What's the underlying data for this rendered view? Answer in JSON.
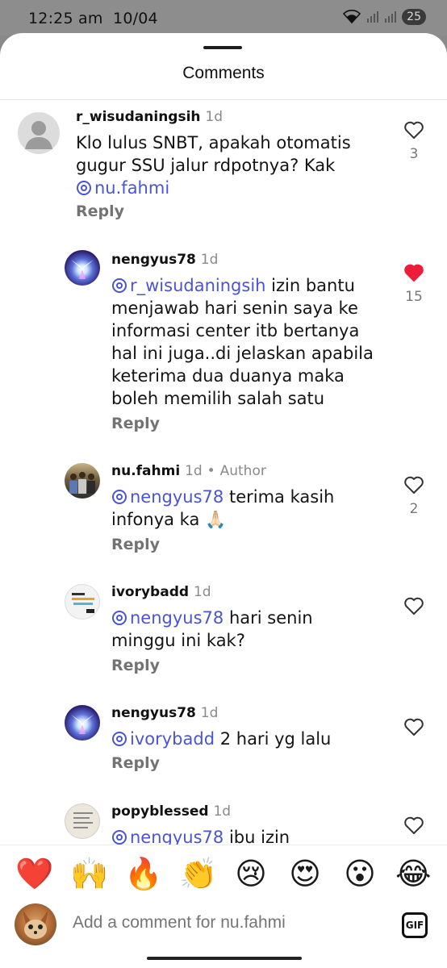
{
  "status": {
    "time": "12:25 am",
    "date": "10/04",
    "battery": "25"
  },
  "sheet": {
    "title": "Comments"
  },
  "comments": [
    {
      "username": "r_wisudaningsih",
      "time": "1d",
      "line1": "Klo lulus SNBT, apakah otomatis",
      "line2": "gugur SSU jalur rdpotnya? Kak",
      "mention": "nu.fahmi",
      "reply": "Reply",
      "likes": "3",
      "liked": false
    },
    {
      "username": "nengyus78",
      "time": "1d",
      "mention": "r_wisudaningsih",
      "line1_rest": "izin bantu",
      "line2": "menjawab hari senin saya ke",
      "line3": "informasi center itb bertanya",
      "line4": "hal ini juga..di jelaskan apabila",
      "line5": "keterima dua duanya maka",
      "line6": "boleh memilih salah satu",
      "reply": "Reply",
      "likes": "15",
      "liked": true
    },
    {
      "username": "nu.fahmi",
      "time": "1d",
      "separator": "•",
      "role": "Author",
      "mention": "nengyus78",
      "line1_rest": "terima kasih",
      "line2": "infonya ka",
      "emoji": "🙏🏻",
      "reply": "Reply",
      "likes": "2",
      "liked": false
    },
    {
      "username": "ivorybadd",
      "time": "1d",
      "mention": "nengyus78",
      "line1_rest": "hari senin",
      "line2": "minggu ini kak?",
      "reply": "Reply",
      "likes": "",
      "liked": false
    },
    {
      "username": "nengyus78",
      "time": "1d",
      "mention": "ivorybadd",
      "line1_rest": "2 hari yg lalu",
      "reply": "Reply",
      "likes": "",
      "liked": false
    },
    {
      "username": "popyblessed",
      "time": "1d",
      "mention": "nengyus78",
      "line1_rest": "ibu izin"
    }
  ],
  "reactions": [
    "❤️",
    "🙌",
    "🔥",
    "👏",
    "😢",
    "😍",
    "😮",
    "😂"
  ],
  "composer": {
    "placeholder": "Add a comment for nu.fahmi",
    "gif_label": "GIF"
  },
  "colors": {
    "mention": "#4a54d6",
    "like_active": "#ed1c3a",
    "meta": "#8a8a8a"
  }
}
